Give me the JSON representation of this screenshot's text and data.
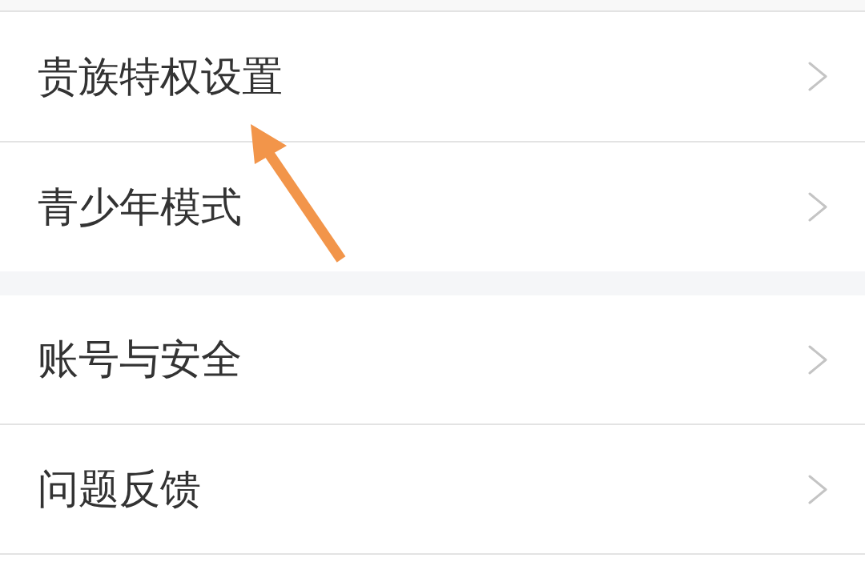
{
  "groups": [
    {
      "items": [
        {
          "label": "贵族特权设置"
        },
        {
          "label": "青少年模式"
        }
      ]
    },
    {
      "items": [
        {
          "label": "账号与安全"
        },
        {
          "label": "问题反馈"
        }
      ]
    }
  ]
}
